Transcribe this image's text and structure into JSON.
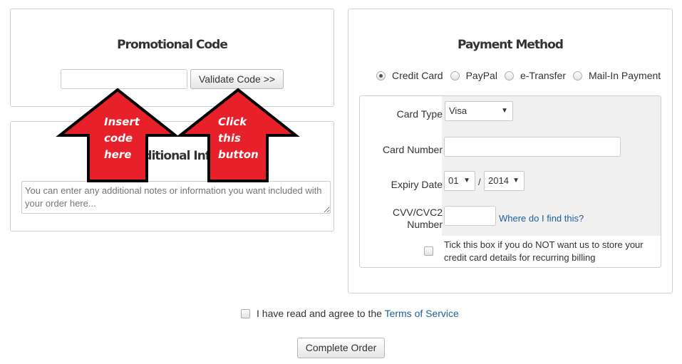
{
  "promo": {
    "title": "Promotional Code",
    "code_value": "",
    "validate_label": "Validate Code >>"
  },
  "additional": {
    "title": "Additional Info",
    "notes_placeholder": "You can enter any additional notes or information you want included with your order here..."
  },
  "payment": {
    "title": "Payment Method",
    "options": [
      "Credit Card",
      "PayPal",
      "e-Transfer",
      "Mail-In Payment"
    ],
    "selected_option": "Credit Card",
    "card_type_label": "Card Type",
    "card_type_value": "Visa",
    "card_number_label": "Card Number",
    "expiry_label": "Expiry Date",
    "expiry_month": "01",
    "expiry_separator": "/",
    "expiry_year": "2014",
    "cvv_label_line1": "CVV/CVC2",
    "cvv_label_line2": "Number",
    "cvv_help_link": "Where do I find this?",
    "no_store_text": "Tick this box if you do NOT want us to store your credit card details for recurring billing"
  },
  "terms": {
    "text": "I have read and agree to the",
    "link": "Terms of Service"
  },
  "complete_label": "Complete Order",
  "annotations": {
    "left_arrow": [
      "Insert",
      "code",
      "here"
    ],
    "right_arrow": [
      "Click",
      "this",
      "button"
    ]
  },
  "colors": {
    "arrow_fill": "#e8202a",
    "arrow_stroke": "#000000",
    "link": "#1f5e9e"
  }
}
